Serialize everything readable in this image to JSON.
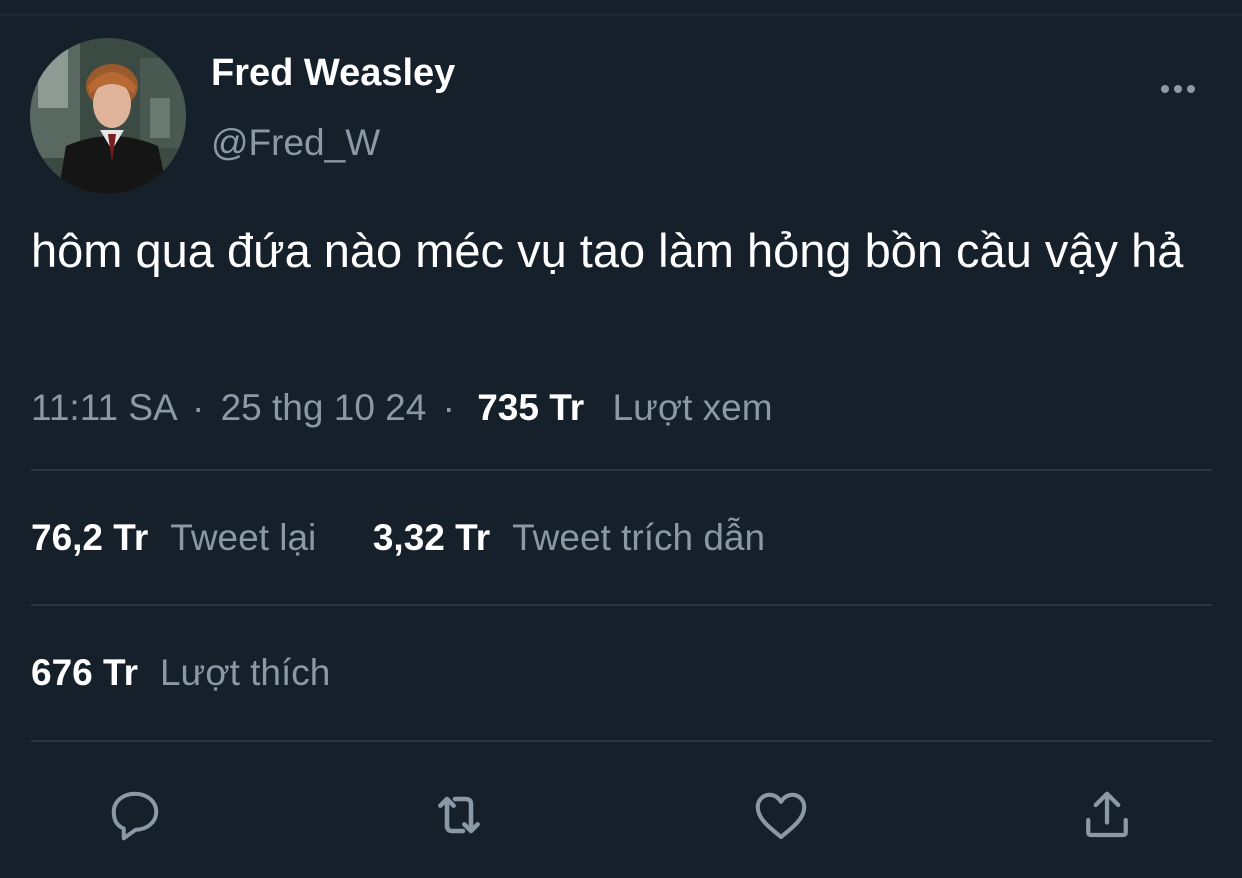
{
  "tweet": {
    "author": {
      "display_name": "Fred Weasley",
      "handle": "@Fred_W",
      "avatar_icon": "profile-photo"
    },
    "text": "hôm qua đứa nào méc vụ tao làm hỏng bồn cầu vậy hả",
    "time": "11:11 SA",
    "date": "25 thg 10 24",
    "separator": "·",
    "views": {
      "count": "735 Tr",
      "label": "Lượt xem"
    }
  },
  "stats": {
    "retweets": {
      "count": "76,2 Tr",
      "label": "Tweet lại"
    },
    "quotes": {
      "count": "3,32 Tr",
      "label": "Tweet trích dẫn"
    },
    "likes": {
      "count": "676 Tr",
      "label": "Lượt thích"
    }
  },
  "actions": {
    "icons": [
      "reply-icon",
      "retweet-icon",
      "like-icon",
      "share-icon"
    ],
    "icon_color": "#8b98a5"
  },
  "theme": {
    "background": "#15202b",
    "text_primary": "#ffffff",
    "text_secondary": "#8b98a5",
    "divider": "#2b3540"
  }
}
